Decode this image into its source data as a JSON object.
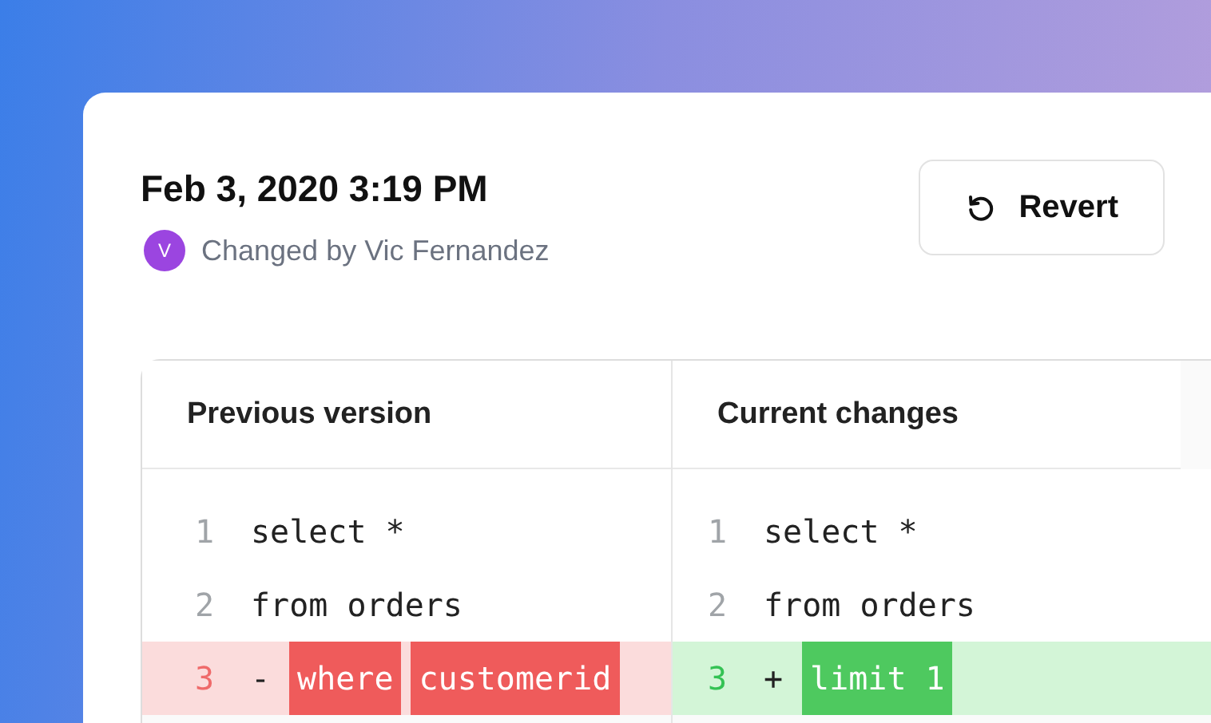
{
  "revision": {
    "timestamp": "Feb 3, 2020 3:19 PM",
    "author_initial": "V",
    "author_text": "Changed by Vic Fernandez"
  },
  "revert_button": {
    "label": "Revert"
  },
  "panes": [
    {
      "title": "Previous version",
      "lines": [
        {
          "number": "1",
          "kind": "context",
          "segments": [
            {
              "text": "select *",
              "highlight": false
            }
          ]
        },
        {
          "number": "2",
          "kind": "context",
          "segments": [
            {
              "text": "from orders",
              "highlight": false
            }
          ]
        },
        {
          "number": "3",
          "kind": "removed",
          "sign": "-",
          "segments": [
            {
              "text": "where",
              "highlight": true
            },
            {
              "text": "customerid",
              "highlight": true
            }
          ]
        }
      ]
    },
    {
      "title": "Current changes",
      "lines": [
        {
          "number": "1",
          "kind": "context",
          "segments": [
            {
              "text": "select *",
              "highlight": false
            }
          ]
        },
        {
          "number": "2",
          "kind": "context",
          "segments": [
            {
              "text": "from orders",
              "highlight": false
            }
          ]
        },
        {
          "number": "3",
          "kind": "added",
          "sign": "+",
          "segments": [
            {
              "text": "limit 1",
              "highlight": true
            }
          ]
        }
      ]
    }
  ]
}
